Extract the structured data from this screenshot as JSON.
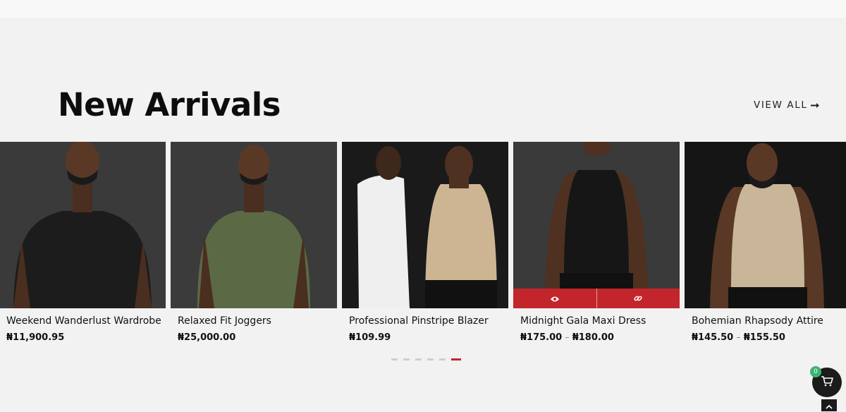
{
  "section": {
    "title": "New Arrivals",
    "view_all_label": "VIEW ALL"
  },
  "products": [
    {
      "title": "Weekend Wanderlust Wardrobe",
      "price": "₦11,900.95",
      "shirt_color": "#1c1c1c",
      "bg": "#3a3a3a"
    },
    {
      "title": "Relaxed Fit Joggers",
      "price": "₦25,000.00",
      "shirt_color": "#5b6a45",
      "bg": "#3b3b3b"
    },
    {
      "title": "Professional Pinstripe Blazer",
      "price": "₦109.99",
      "shirt_color": "#cdb594",
      "bg": "#1a1a1a"
    },
    {
      "title": "Midnight Gala Maxi Dress",
      "price_low": "₦175.00",
      "price_sep": "–",
      "price_high": "₦180.00",
      "shirt_color": "#161616",
      "bg": "#3a3a3a"
    },
    {
      "title": "Bohemian Rhapsody Attire",
      "price_low": "₦145.50",
      "price_sep": "–",
      "price_high": "₦155.50",
      "shirt_color": "#c9b698",
      "bg": "#151515"
    }
  ],
  "carousel": {
    "page_count": 6,
    "active_page": 6
  },
  "cart": {
    "count": "0"
  },
  "colors": {
    "accent": "#c2262c",
    "badge": "#3cb371"
  },
  "icons": {
    "quick_view": "eye-icon",
    "link": "link-icon",
    "cart": "cart-icon",
    "scroll_top": "chevron-up-icon",
    "view_all": "arrow-right-icon"
  }
}
